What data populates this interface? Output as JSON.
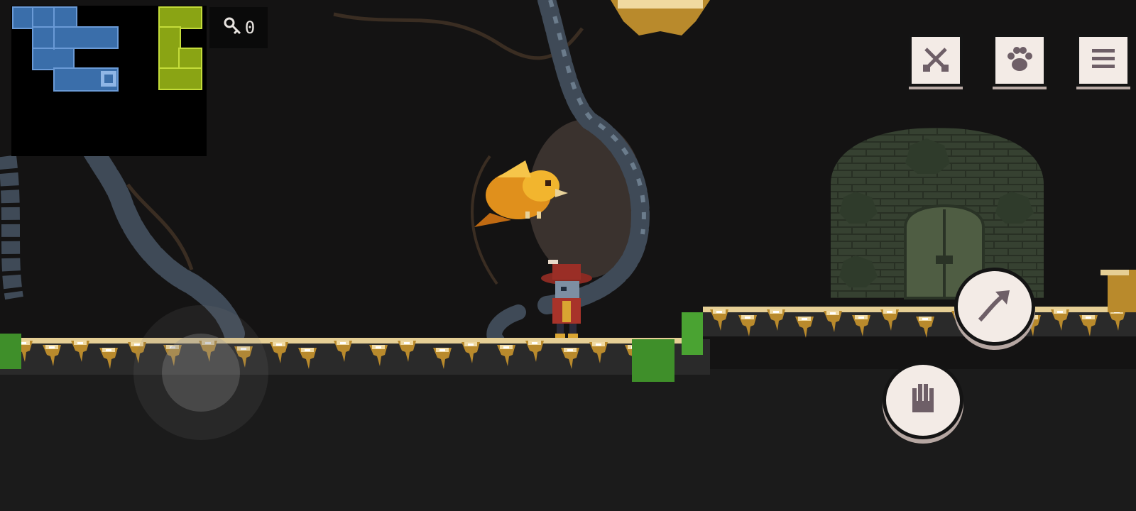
{
  "hud": {
    "key_count": "0",
    "key_icon": "key-icon",
    "minimap_icon": "minimap"
  },
  "controls": {
    "attack_icon": "crossed-swords-icon",
    "pet_icon": "paw-icon",
    "menu_icon": "menu-icon",
    "jump_icon": "jump-arrow-icon",
    "interact_icon": "hand-icon",
    "joystick_icon": "virtual-joystick"
  },
  "colors": {
    "minimap_blue": "#3a6eaa",
    "minimap_green": "#8aa414",
    "button_face": "#f3ebe6",
    "button_icon": "#6e5f67"
  }
}
